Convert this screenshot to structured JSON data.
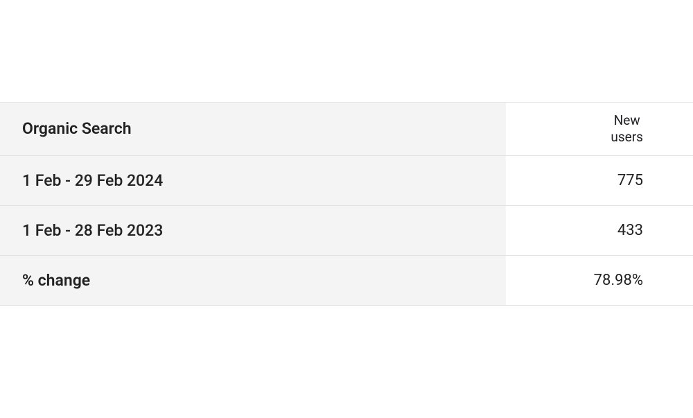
{
  "table": {
    "row_header_label": "Organic Search",
    "metric_label_line1": "New",
    "metric_label_line2": "users",
    "rows": [
      {
        "label": "1 Feb - 29 Feb 2024",
        "value": "775"
      },
      {
        "label": "1 Feb - 28 Feb 2023",
        "value": "433"
      },
      {
        "label": "% change",
        "value": "78.98%"
      }
    ]
  }
}
